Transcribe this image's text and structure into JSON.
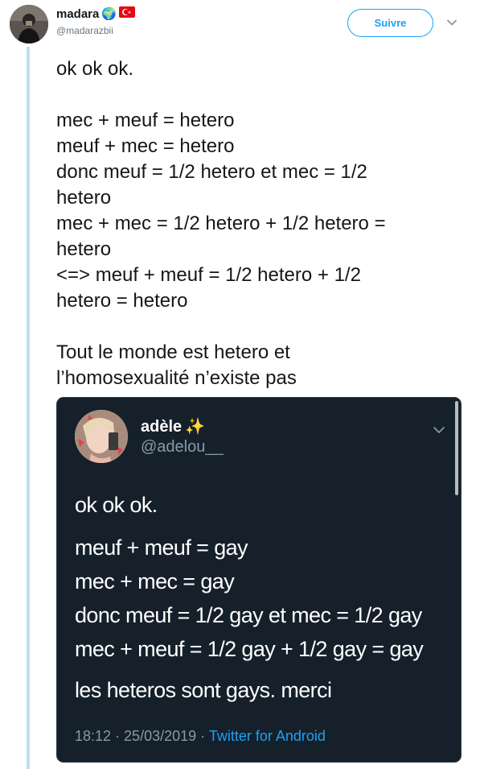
{
  "author": {
    "name": "madara",
    "emoji_globe": "🌍",
    "flag": "🇹🇷",
    "handle": "@madarazbii"
  },
  "follow_button": {
    "label": "Suivre"
  },
  "colors": {
    "accent": "#1da1f2",
    "thread_line": "#b9e0f3",
    "card_bg": "#15202b",
    "card_muted": "#8899a6"
  },
  "tweet": {
    "lines": [
      "ok ok ok.",
      "",
      "mec + meuf = hetero",
      "meuf + mec = hetero",
      "donc meuf = 1/2 hetero et mec = 1/2",
      "hetero",
      "mec + mec = 1/2 hetero + 1/2 hetero =",
      "hetero",
      "<=> meuf + meuf = 1/2 hetero + 1/2",
      "hetero = hetero",
      "",
      "Tout le monde est hetero et",
      "l’homosexualité n’existe pas"
    ]
  },
  "quoted": {
    "name": "adèle",
    "name_emoji": "✨",
    "handle": "@adelou__",
    "lines": [
      "ok ok ok.",
      "meuf + meuf = gay",
      "mec + mec = gay",
      "donc meuf = 1/2 gay et mec = 1/2 gay",
      "mec + meuf = 1/2 gay + 1/2 gay = gay",
      "les heteros sont gays. merci"
    ],
    "footer": {
      "time": "18:12",
      "sep1": " · ",
      "date": "25/03/2019",
      "sep2": " · ",
      "source": "Twitter for Android"
    }
  },
  "icons": {
    "caret": "chevron-down-icon"
  }
}
